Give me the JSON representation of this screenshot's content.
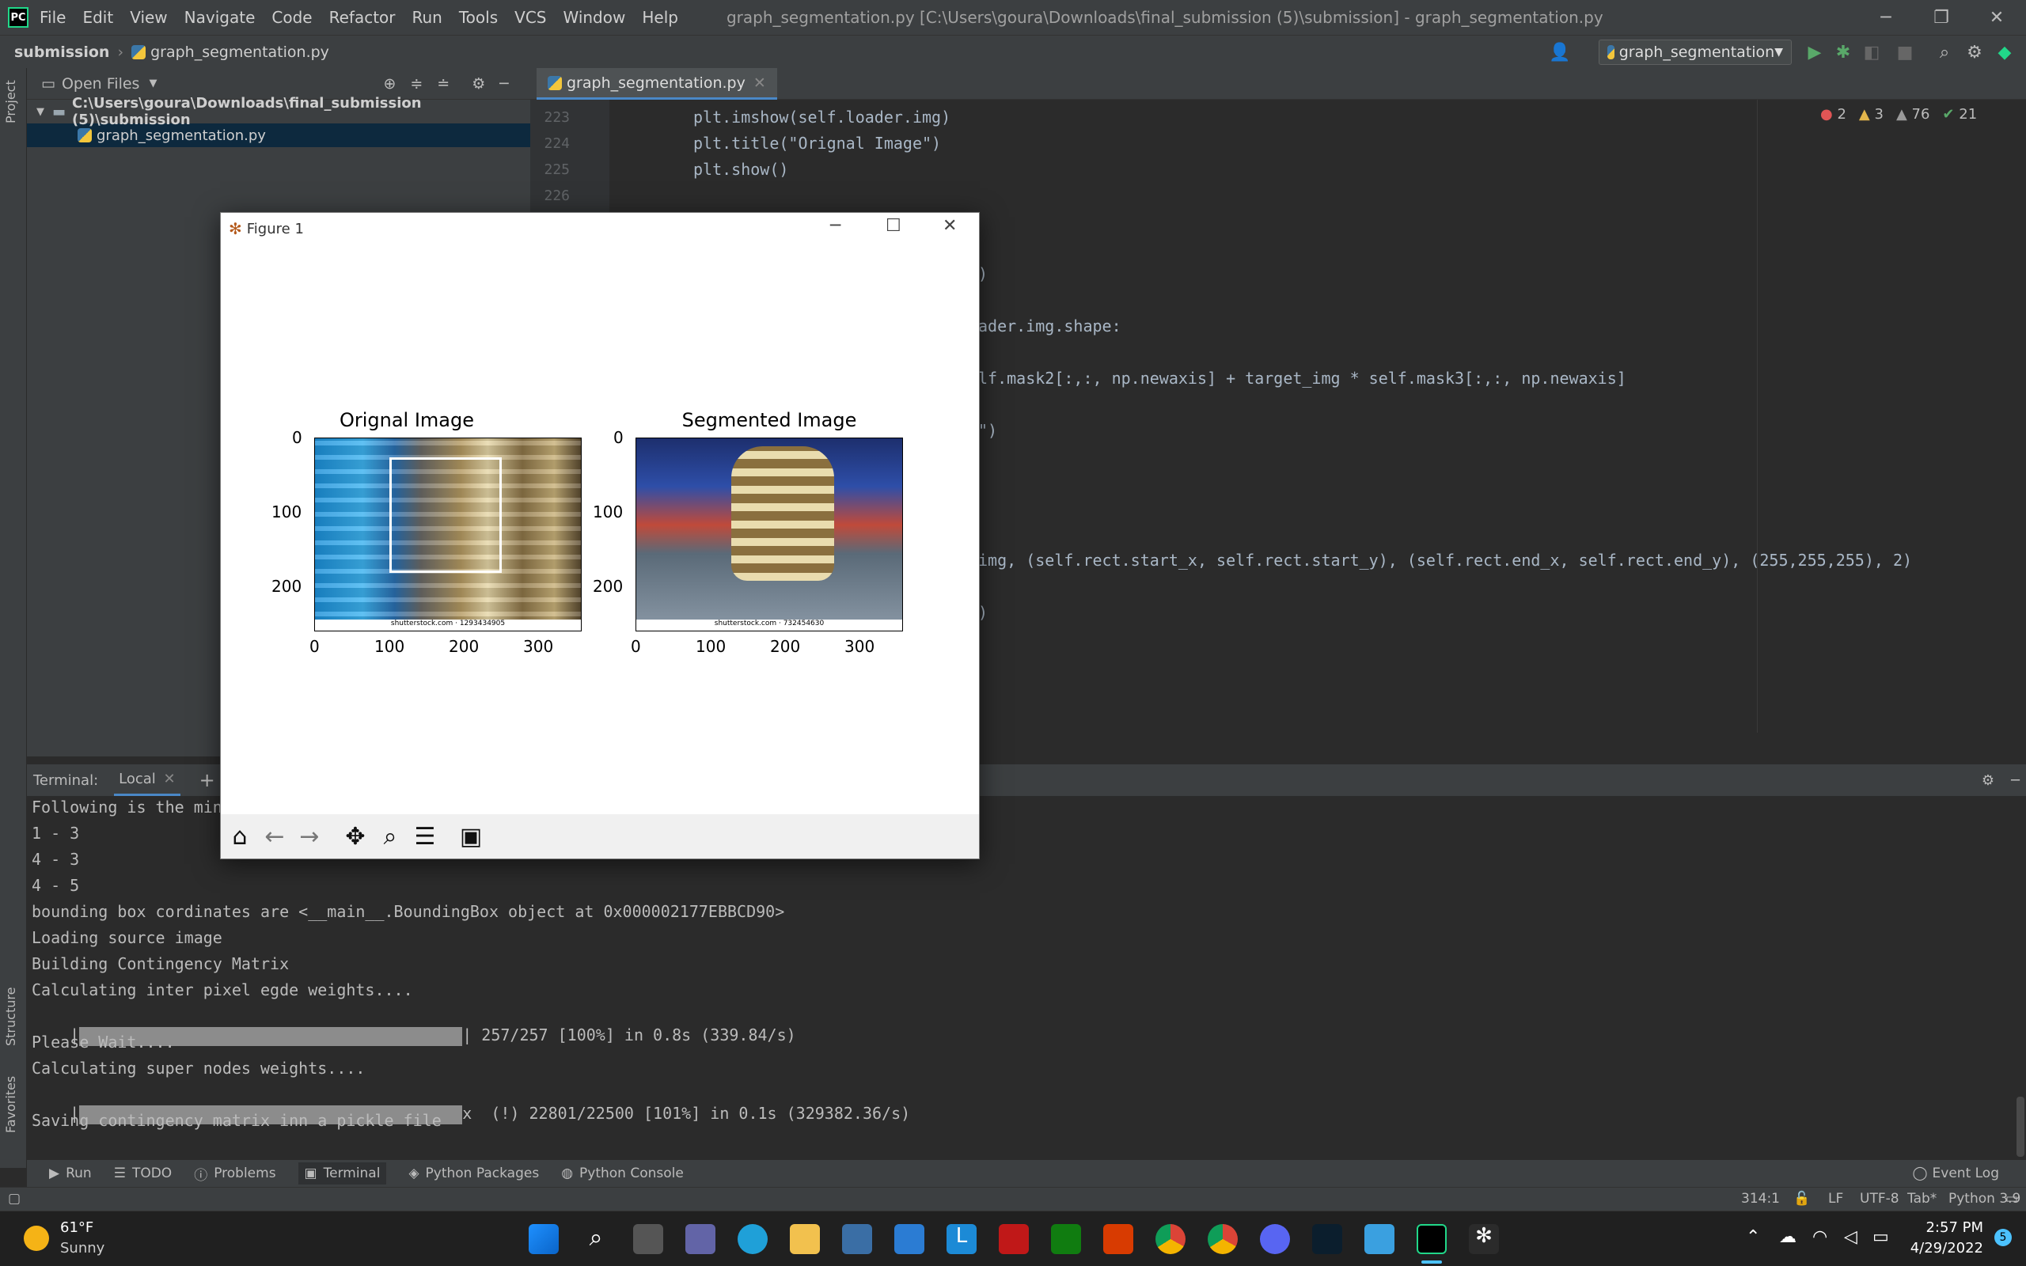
{
  "menubar": {
    "logo": "PC",
    "items": [
      "File",
      "Edit",
      "View",
      "Navigate",
      "Code",
      "Refactor",
      "Run",
      "Tools",
      "VCS",
      "Window",
      "Help"
    ],
    "title": "graph_segmentation.py [C:\\Users\\goura\\Downloads\\final_submission (5)\\submission] - graph_segmentation.py"
  },
  "navbar": {
    "project": "submission",
    "file": "graph_segmentation.py",
    "run_config": "graph_segmentation"
  },
  "project_panel": {
    "header": "Open Files",
    "folder": "C:\\Users\\goura\\Downloads\\final_submission (5)\\submission",
    "file": "graph_segmentation.py",
    "side_tab": "Project"
  },
  "editor": {
    "tab": "graph_segmentation.py",
    "line_numbers": [
      "223",
      "224",
      "225",
      "226"
    ],
    "lines": [
      "plt.imshow(self.loader.img)",
      "plt.title(\"Orignal Image\")",
      "plt.show()",
      ")",
      "ader.img.shape:",
      "lf.mask2[:,:, np.newaxis] + target_img * self.mask3[:,:, np.newaxis]",
      "\")",
      "img, (self.rect.start_x, self.rect.start_y), (self.rect.end_x, self.rect.end_y), (255,255,255), 2)",
      ")"
    ],
    "inspections": {
      "errors": "2",
      "warnings": "3",
      "weak": "76",
      "ok": "21"
    }
  },
  "terminal": {
    "label": "Terminal:",
    "tab": "Local",
    "lines": [
      "Following is the min",
      "1 - 3",
      "4 - 3",
      "4 - 5",
      "bounding box cordinates are <__main__.BoundingBox object at 0x000002177EBBCD90>",
      "Loading source image",
      "Building Contingency Matrix",
      "Calculating inter pixel egde weights....",
      "| 257/257 [100%] in 0.8s (339.84/s)",
      "Please Wait....",
      "Calculating super nodes weights....",
      "x  (!) 22801/22500 [101%] in 0.1s (329382.36/s)",
      "Saving contingency matrix inn a pickle file"
    ]
  },
  "bottom_tools": [
    "Run",
    "TODO",
    "Problems",
    "Terminal",
    "Python Packages",
    "Python Console"
  ],
  "event_log": "Event Log",
  "status": {
    "position": "314:1",
    "line_sep": "LF",
    "encoding": "UTF-8",
    "indent": "Tab*",
    "interpreter": "Python 3.9"
  },
  "side_tabs": {
    "structure": "Structure",
    "favorites": "Favorites"
  },
  "figure": {
    "title": "Figure 1",
    "left_title": "Orignal Image",
    "right_title": "Segmented Image",
    "y_ticks": [
      "0",
      "100",
      "200"
    ],
    "x_ticks": [
      "0",
      "100",
      "200",
      "300"
    ],
    "left_watermark": "shutterstock.com · 1293434905",
    "right_watermark": "shutterstock.com · 732454630"
  },
  "taskbar": {
    "temp": "61°F",
    "weather": "Sunny",
    "time": "2:57 PM",
    "date": "4/29/2022",
    "notifications": "5"
  }
}
